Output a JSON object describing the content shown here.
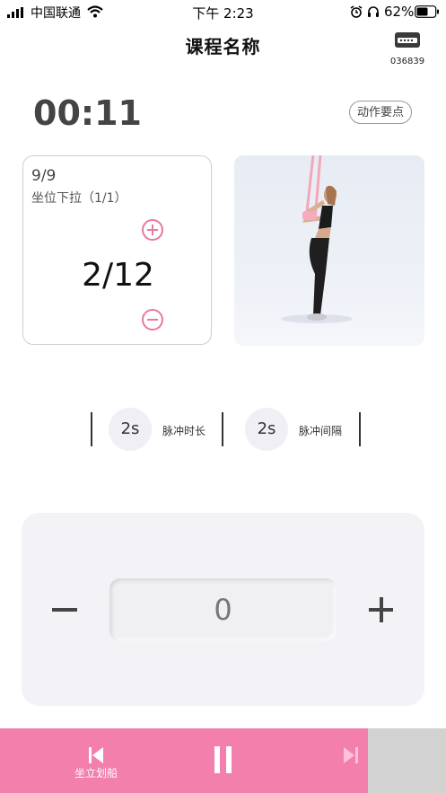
{
  "status_bar": {
    "carrier": "中国联通",
    "time": "下午 2:23",
    "battery_pct": "62%"
  },
  "header": {
    "title": "课程名称",
    "device_id": "036839"
  },
  "workout": {
    "timer": "00:11",
    "tips_label": "动作要点",
    "set_progress": "9/9",
    "exercise_name": "坐位下拉（1/1）",
    "reps": "2/12"
  },
  "pulse": {
    "duration_value": "2s",
    "duration_label": "脉冲时长",
    "interval_value": "2s",
    "interval_label": "脉冲间隔"
  },
  "control": {
    "value": "0"
  },
  "bottom_bar": {
    "prev_label": "坐立划船"
  },
  "colors": {
    "accent": "#f27fac",
    "panel": "#f2f2f7",
    "disabled": "#d2d2d2"
  }
}
